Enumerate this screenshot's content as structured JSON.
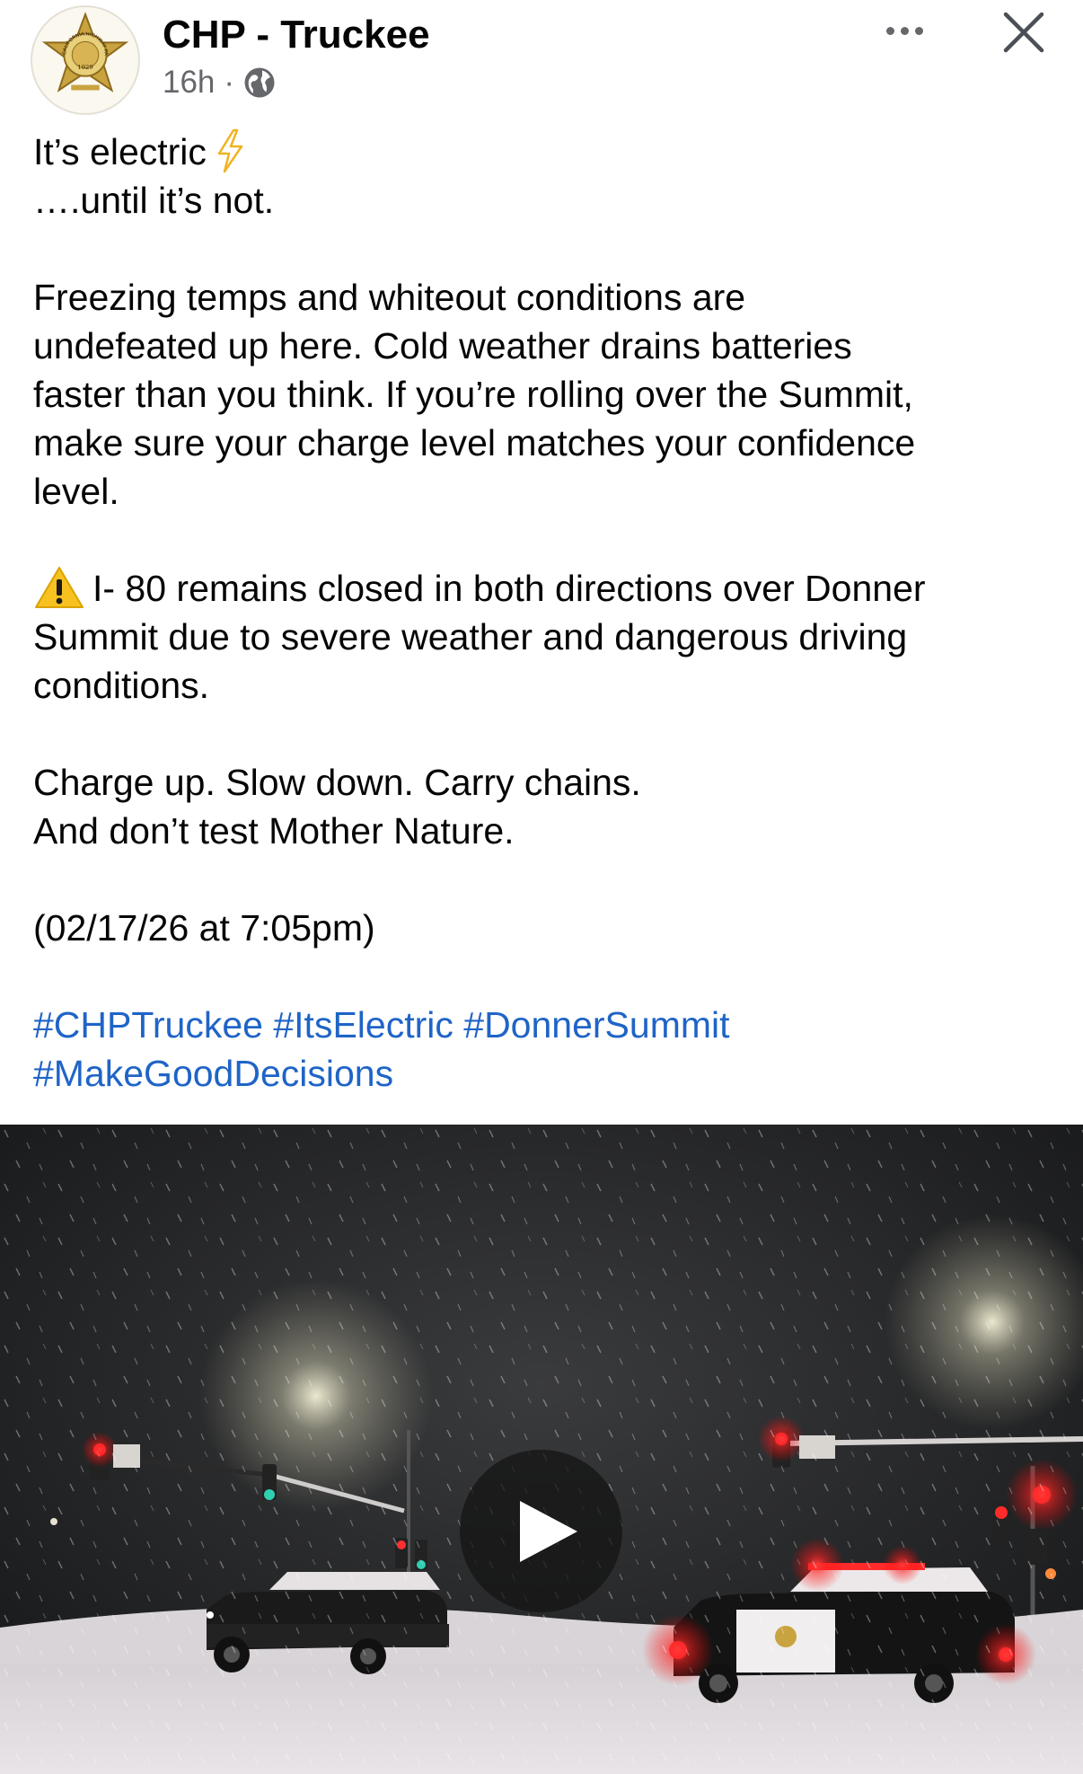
{
  "post": {
    "page_name": "CHP - Truckee",
    "time": "16h",
    "separator": "·",
    "privacy_icon": "globe-icon",
    "avatar_icon": "chp-badge-logo",
    "seal_text": "CALIFORNIA HIGHWAY PATROL",
    "seal_year": "1929",
    "more_icon": "more-horizontal-icon",
    "close_icon": "close-icon"
  },
  "body": {
    "line1": "It’s electric",
    "line1_icon": "lightning-bolt-icon",
    "line2": "….until it’s not.",
    "para2": [
      "Freezing temps and whiteout conditions are",
      "undefeated up here. Cold weather drains batteries",
      "faster than you think. If you’re rolling over the Summit,",
      "make sure your charge level matches your confidence",
      "level."
    ],
    "warning_icon": "warning-icon",
    "para3": [
      "I- 80 remains closed in both directions over Donner",
      "Summit due to severe weather and dangerous driving",
      "conditions."
    ],
    "para4": [
      "Charge up. Slow down. Carry chains.",
      "And don’t test Mother Nature."
    ],
    "timestamp": "(02/17/26 at 7:05pm)",
    "hashtags": [
      "#CHPTruckee",
      "#ItsElectric",
      "#DonnerSummit",
      "#MakeGoodDecisions"
    ],
    "link_color": "#1f64c7"
  },
  "video": {
    "play_icon": "play-icon"
  }
}
